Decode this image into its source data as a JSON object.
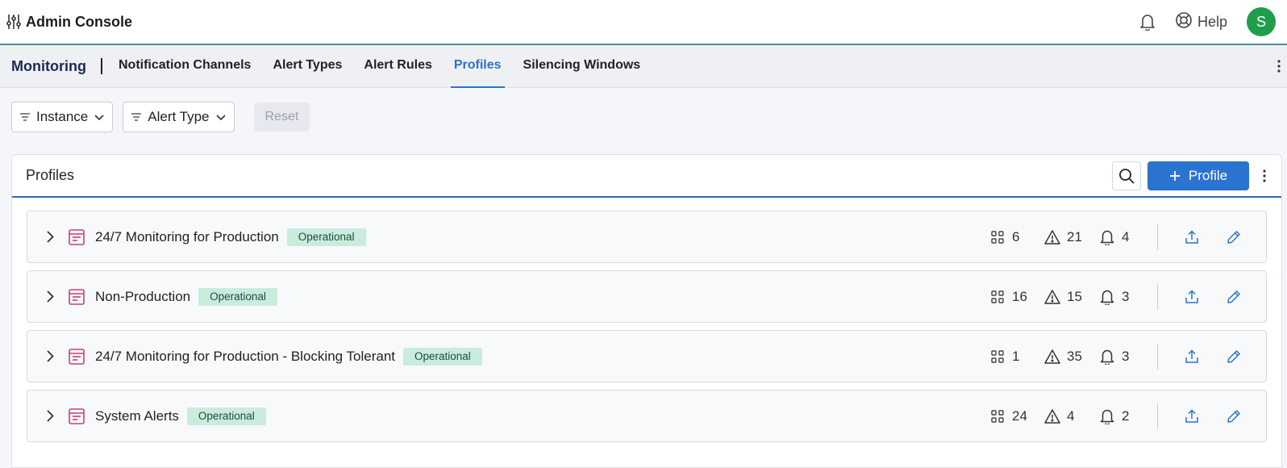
{
  "header": {
    "app_title": "Admin Console",
    "help_label": "Help",
    "avatar_initial": "S"
  },
  "nav": {
    "section": "Monitoring",
    "tabs": [
      {
        "label": "Notification Channels",
        "active": false
      },
      {
        "label": "Alert Types",
        "active": false
      },
      {
        "label": "Alert Rules",
        "active": false
      },
      {
        "label": "Profiles",
        "active": true
      },
      {
        "label": "Silencing Windows",
        "active": false
      }
    ]
  },
  "filters": {
    "instance_label": "Instance",
    "alert_type_label": "Alert Type",
    "reset_label": "Reset"
  },
  "panel": {
    "title": "Profiles",
    "add_label": "Profile"
  },
  "profiles": [
    {
      "name": "24/7 Monitoring for Production",
      "status": "Operational",
      "instances": "6",
      "alerts": "21",
      "channels": "4"
    },
    {
      "name": "Non-Production",
      "status": "Operational",
      "instances": "16",
      "alerts": "15",
      "channels": "3"
    },
    {
      "name": "24/7 Monitoring for Production - Blocking Tolerant",
      "status": "Operational",
      "instances": "1",
      "alerts": "35",
      "channels": "3"
    },
    {
      "name": "System Alerts",
      "status": "Operational",
      "instances": "24",
      "alerts": "4",
      "channels": "2"
    }
  ],
  "colors": {
    "accent": "#2b73c8",
    "primary_button": "#2b73d1",
    "badge_bg": "#c9ecdd",
    "avatar": "#1f9d4c",
    "profile_icon": "#c8406e"
  },
  "icons": {
    "logo": "sliders-icon",
    "bell": "bell-icon",
    "help": "lifebuoy-icon",
    "search": "search-icon",
    "plus": "plus-icon",
    "kebab": "kebab-icon",
    "chevron": "chevron-right-icon",
    "profile": "document-icon",
    "instances": "grid-icon",
    "alerts": "warning-icon",
    "channels": "bell-icon",
    "export": "export-icon",
    "edit": "pencil-icon"
  }
}
